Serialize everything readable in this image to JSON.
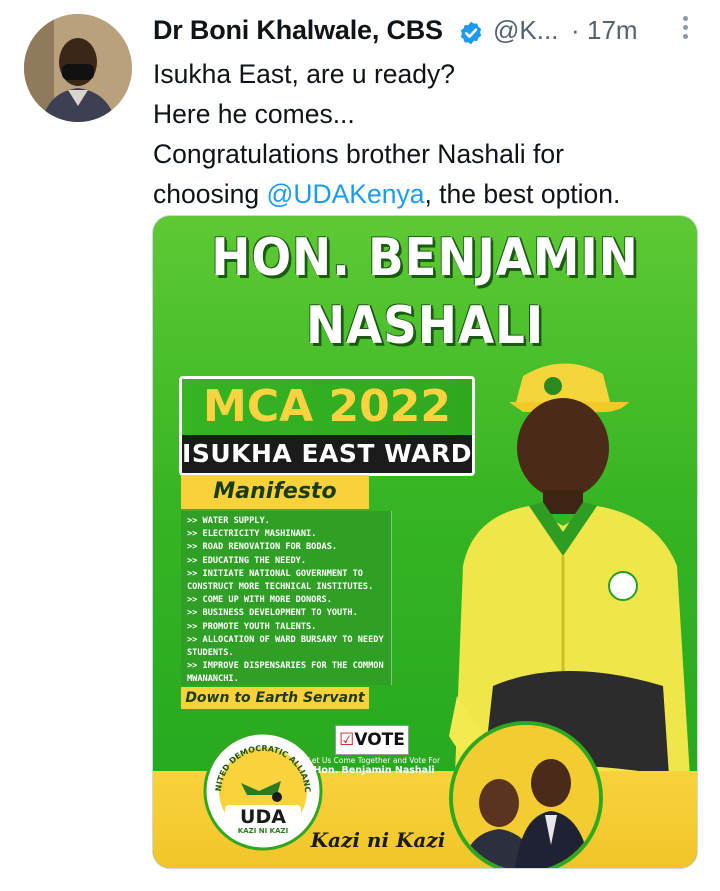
{
  "tweet": {
    "author_name": "Dr Boni Khalwale, CBS",
    "handle": "@K...",
    "separator": "·",
    "time": "17m",
    "text_lines": [
      {
        "text": "Isukha East, are u ready?"
      },
      {
        "text": "Here he comes..."
      },
      {
        "text": "Congratulations brother Nashali for"
      },
      {
        "before": "choosing ",
        "mention": "@UDAKenya",
        "after": ", the best option."
      }
    ]
  },
  "poster": {
    "name_line1": "HON. BENJAMIN",
    "name_line2": "NASHALI",
    "mca": "MCA 2022",
    "ward": "ISUKHA EAST WARD",
    "manifesto_title": "Manifesto",
    "manifesto_items": [
      "WATER SUPPLY.",
      "ELECTRICITY MASHINANI.",
      "ROAD RENOVATION FOR BODAS.",
      "EDUCATING THE NEEDY.",
      "INITIATE NATIONAL GOVERNMENT TO CONSTRUCT MORE TECHNICAL INSTITUTES.",
      "COME UP WITH MORE DONORS.",
      "BUSINESS DEVELOPMENT TO YOUTH.",
      "PROMOTE YOUTH TALENTS.",
      "ALLOCATION OF WARD BURSARY TO NEEDY STUDENTS.",
      "IMPROVE DISPENSARIES FOR THE COMMON MWANANCHI."
    ],
    "slogan": "Down to Earth Servant",
    "vote_label": "VOTE",
    "vote_check": "☑",
    "vote_line1": "Let Us Come Together and Vote For",
    "vote_line2": "Hon. Benjamin Nashali",
    "kazi": "Kazi ni Kazi",
    "party_ring": "UNITED DEMOCRATIC ALLIANCE",
    "party_abbr": "UDA",
    "party_motto": "KAZI NI KAZI"
  },
  "colors": {
    "poster_green": "#36b423",
    "poster_yellow": "#f7d23a",
    "link_blue": "#1d9bf0",
    "meta_gray": "#536471"
  },
  "icons": {
    "verified": "verified-badge-icon",
    "more": "more-options-icon"
  }
}
